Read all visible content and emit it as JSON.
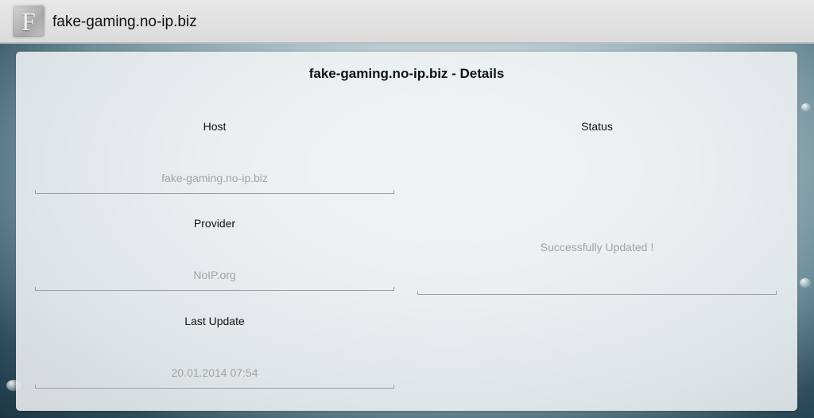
{
  "actionbar": {
    "icon_letter": "F",
    "title": "fake-gaming.no-ip.biz"
  },
  "card": {
    "title": "fake-gaming.no-ip.biz - Details",
    "host": {
      "label": "Host",
      "value": "fake-gaming.no-ip.biz"
    },
    "provider": {
      "label": "Provider",
      "value": "NoIP.org"
    },
    "last_update": {
      "label": "Last Update",
      "value": "20.01.2014 07:54"
    },
    "status": {
      "label": "Status",
      "value": "Successfully Updated !"
    }
  }
}
